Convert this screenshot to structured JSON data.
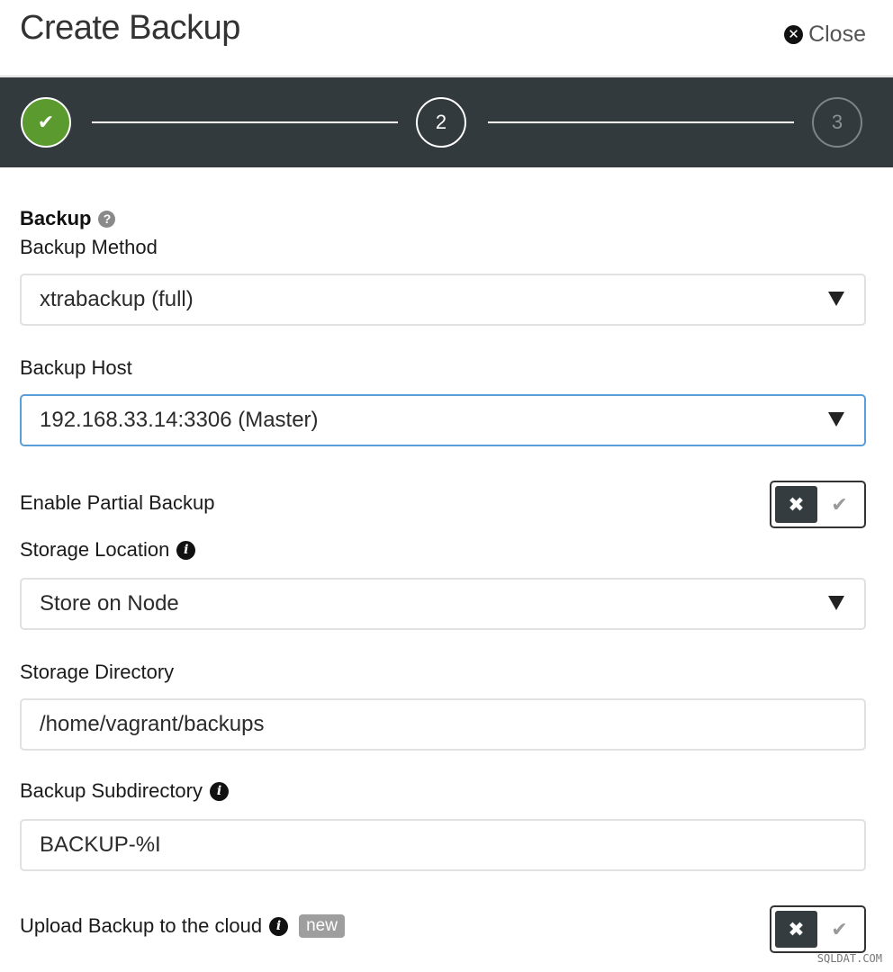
{
  "header": {
    "title": "Create Backup",
    "close_label": "Close",
    "close_icon": "times-circle-icon"
  },
  "stepper": {
    "current_step": 2,
    "steps": [
      {
        "label": "✔",
        "state": "complete"
      },
      {
        "label": "2",
        "state": "active"
      },
      {
        "label": "3",
        "state": "pending"
      }
    ],
    "colors": {
      "background": "#323a3e",
      "complete": "#5a9a2e",
      "active": "#ffffff",
      "pending": "#7d8487"
    }
  },
  "form": {
    "section_title": "Backup",
    "backup_method": {
      "label": "Backup Method",
      "value": "xtrabackup (full)"
    },
    "backup_host": {
      "label": "Backup Host",
      "value": "192.168.33.14:3306 (Master)"
    },
    "partial_backup": {
      "label": "Enable Partial Backup",
      "enabled": false
    },
    "storage_location": {
      "label": "Storage Location",
      "value": "Store on Node"
    },
    "storage_directory": {
      "label": "Storage Directory",
      "value": "/home/vagrant/backups"
    },
    "backup_subdirectory": {
      "label": "Backup Subdirectory",
      "value": "BACKUP-%I"
    },
    "upload_cloud": {
      "label": "Upload Backup to the cloud",
      "badge": "new",
      "enabled": false
    }
  },
  "toggle_glyphs": {
    "off": "✖",
    "on": "✔"
  },
  "watermark": "SQLDAT.COM",
  "colors": {
    "focus_border": "#5b9dd9",
    "field_border": "#e1e1e1"
  }
}
